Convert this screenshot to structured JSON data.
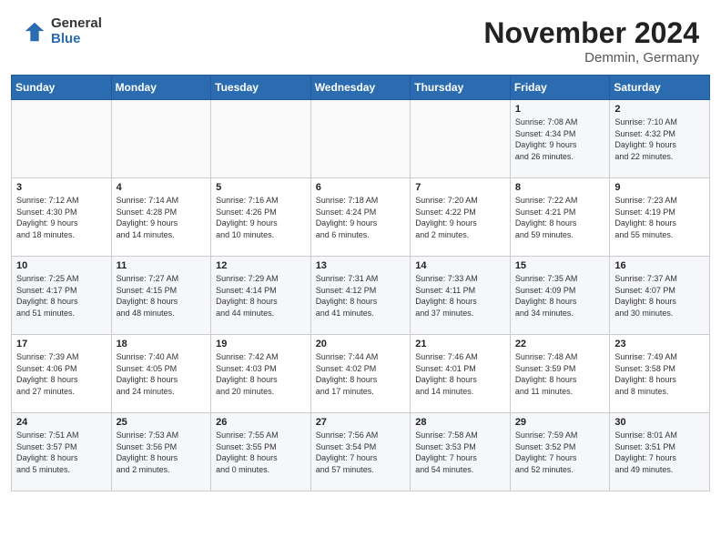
{
  "header": {
    "logo_general": "General",
    "logo_blue": "Blue",
    "month_title": "November 2024",
    "location": "Demmin, Germany"
  },
  "weekdays": [
    "Sunday",
    "Monday",
    "Tuesday",
    "Wednesday",
    "Thursday",
    "Friday",
    "Saturday"
  ],
  "weeks": [
    [
      {
        "day": "",
        "info": ""
      },
      {
        "day": "",
        "info": ""
      },
      {
        "day": "",
        "info": ""
      },
      {
        "day": "",
        "info": ""
      },
      {
        "day": "",
        "info": ""
      },
      {
        "day": "1",
        "info": "Sunrise: 7:08 AM\nSunset: 4:34 PM\nDaylight: 9 hours\nand 26 minutes."
      },
      {
        "day": "2",
        "info": "Sunrise: 7:10 AM\nSunset: 4:32 PM\nDaylight: 9 hours\nand 22 minutes."
      }
    ],
    [
      {
        "day": "3",
        "info": "Sunrise: 7:12 AM\nSunset: 4:30 PM\nDaylight: 9 hours\nand 18 minutes."
      },
      {
        "day": "4",
        "info": "Sunrise: 7:14 AM\nSunset: 4:28 PM\nDaylight: 9 hours\nand 14 minutes."
      },
      {
        "day": "5",
        "info": "Sunrise: 7:16 AM\nSunset: 4:26 PM\nDaylight: 9 hours\nand 10 minutes."
      },
      {
        "day": "6",
        "info": "Sunrise: 7:18 AM\nSunset: 4:24 PM\nDaylight: 9 hours\nand 6 minutes."
      },
      {
        "day": "7",
        "info": "Sunrise: 7:20 AM\nSunset: 4:22 PM\nDaylight: 9 hours\nand 2 minutes."
      },
      {
        "day": "8",
        "info": "Sunrise: 7:22 AM\nSunset: 4:21 PM\nDaylight: 8 hours\nand 59 minutes."
      },
      {
        "day": "9",
        "info": "Sunrise: 7:23 AM\nSunset: 4:19 PM\nDaylight: 8 hours\nand 55 minutes."
      }
    ],
    [
      {
        "day": "10",
        "info": "Sunrise: 7:25 AM\nSunset: 4:17 PM\nDaylight: 8 hours\nand 51 minutes."
      },
      {
        "day": "11",
        "info": "Sunrise: 7:27 AM\nSunset: 4:15 PM\nDaylight: 8 hours\nand 48 minutes."
      },
      {
        "day": "12",
        "info": "Sunrise: 7:29 AM\nSunset: 4:14 PM\nDaylight: 8 hours\nand 44 minutes."
      },
      {
        "day": "13",
        "info": "Sunrise: 7:31 AM\nSunset: 4:12 PM\nDaylight: 8 hours\nand 41 minutes."
      },
      {
        "day": "14",
        "info": "Sunrise: 7:33 AM\nSunset: 4:11 PM\nDaylight: 8 hours\nand 37 minutes."
      },
      {
        "day": "15",
        "info": "Sunrise: 7:35 AM\nSunset: 4:09 PM\nDaylight: 8 hours\nand 34 minutes."
      },
      {
        "day": "16",
        "info": "Sunrise: 7:37 AM\nSunset: 4:07 PM\nDaylight: 8 hours\nand 30 minutes."
      }
    ],
    [
      {
        "day": "17",
        "info": "Sunrise: 7:39 AM\nSunset: 4:06 PM\nDaylight: 8 hours\nand 27 minutes."
      },
      {
        "day": "18",
        "info": "Sunrise: 7:40 AM\nSunset: 4:05 PM\nDaylight: 8 hours\nand 24 minutes."
      },
      {
        "day": "19",
        "info": "Sunrise: 7:42 AM\nSunset: 4:03 PM\nDaylight: 8 hours\nand 20 minutes."
      },
      {
        "day": "20",
        "info": "Sunrise: 7:44 AM\nSunset: 4:02 PM\nDaylight: 8 hours\nand 17 minutes."
      },
      {
        "day": "21",
        "info": "Sunrise: 7:46 AM\nSunset: 4:01 PM\nDaylight: 8 hours\nand 14 minutes."
      },
      {
        "day": "22",
        "info": "Sunrise: 7:48 AM\nSunset: 3:59 PM\nDaylight: 8 hours\nand 11 minutes."
      },
      {
        "day": "23",
        "info": "Sunrise: 7:49 AM\nSunset: 3:58 PM\nDaylight: 8 hours\nand 8 minutes."
      }
    ],
    [
      {
        "day": "24",
        "info": "Sunrise: 7:51 AM\nSunset: 3:57 PM\nDaylight: 8 hours\nand 5 minutes."
      },
      {
        "day": "25",
        "info": "Sunrise: 7:53 AM\nSunset: 3:56 PM\nDaylight: 8 hours\nand 2 minutes."
      },
      {
        "day": "26",
        "info": "Sunrise: 7:55 AM\nSunset: 3:55 PM\nDaylight: 8 hours\nand 0 minutes."
      },
      {
        "day": "27",
        "info": "Sunrise: 7:56 AM\nSunset: 3:54 PM\nDaylight: 7 hours\nand 57 minutes."
      },
      {
        "day": "28",
        "info": "Sunrise: 7:58 AM\nSunset: 3:53 PM\nDaylight: 7 hours\nand 54 minutes."
      },
      {
        "day": "29",
        "info": "Sunrise: 7:59 AM\nSunset: 3:52 PM\nDaylight: 7 hours\nand 52 minutes."
      },
      {
        "day": "30",
        "info": "Sunrise: 8:01 AM\nSunset: 3:51 PM\nDaylight: 7 hours\nand 49 minutes."
      }
    ]
  ]
}
